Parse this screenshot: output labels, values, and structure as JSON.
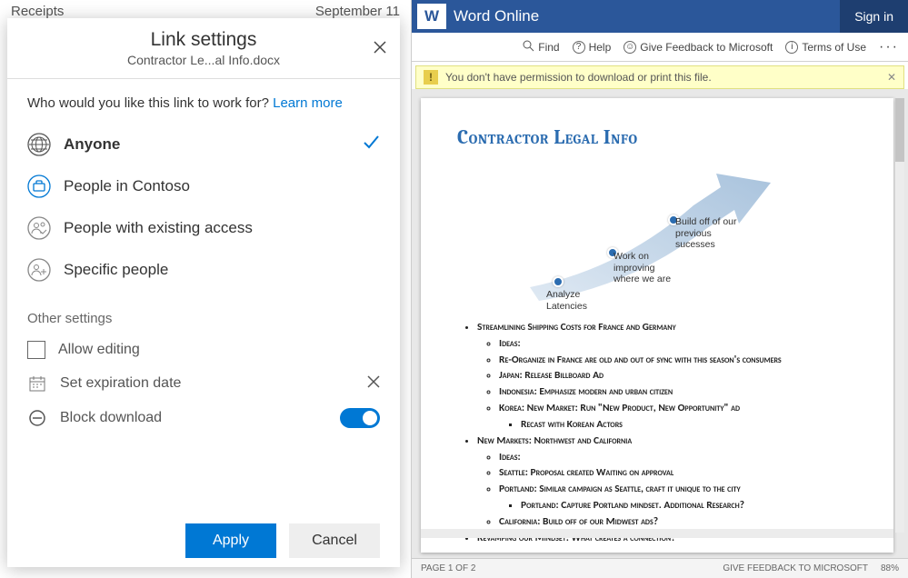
{
  "backdrop": {
    "left": "Receipts",
    "right": "September 11"
  },
  "dialog": {
    "title": "Link settings",
    "subtitle": "Contractor Le...al Info.docx",
    "prompt_prefix": "Who would you like this link to work for? ",
    "learn_more": "Learn more",
    "options": [
      {
        "label": "Anyone",
        "selected": true
      },
      {
        "label": "People in Contoso",
        "selected": false
      },
      {
        "label": "People with existing access",
        "selected": false
      },
      {
        "label": "Specific people",
        "selected": false
      }
    ],
    "other_settings_label": "Other settings",
    "allow_editing": "Allow editing",
    "set_expiration": "Set expiration date",
    "block_download": "Block download",
    "apply": "Apply",
    "cancel": "Cancel"
  },
  "word": {
    "app_name": "Word Online",
    "sign_in": "Sign in",
    "tools": {
      "find": "Find",
      "help": "Help",
      "feedback": "Give Feedback to Microsoft",
      "terms": "Terms of Use"
    },
    "warning": "You don't have permission to download or print this file.",
    "doc": {
      "title": "Contractor Legal Info",
      "bubbles": [
        {
          "text": "Analyze Latencies"
        },
        {
          "text": "Work on improving where we are"
        },
        {
          "text": "Build off of our previous sucesses"
        }
      ],
      "bullets": [
        {
          "t": "Streamlining Shipping Costs for France and Germany",
          "c": [
            {
              "t": "Ideas:"
            },
            {
              "t": "Re-Organize in France are old and out of sync with this season's consumers"
            },
            {
              "t": "Japan: Release  Billboard Ad"
            },
            {
              "t": "Indonesia: Emphasize modern and urban citizen"
            },
            {
              "t": "Korea: New Market:  Run \"New Product, New Opportunity\" ad",
              "c": [
                {
                  "t": "Recast with Korean Actors"
                }
              ]
            }
          ]
        },
        {
          "t": "New Markets: Northwest and California",
          "c": [
            {
              "t": "Ideas:"
            },
            {
              "t": "Seattle: Proposal created Waiting on approval"
            },
            {
              "t": "Portland: Similar campaign as Seattle, craft it unique to the city",
              "c": [
                {
                  "t": "Portland: Capture Portland mindset.  Additional Research?"
                }
              ]
            },
            {
              "t": "California:  Build off of our Midwest ads?"
            }
          ]
        },
        {
          "t": "Revamping our Mindset:  What creates a connection?"
        }
      ]
    },
    "status": {
      "page": "Page 1 of 2",
      "feedback": "Give feedback to Microsoft",
      "zoom": "88%"
    }
  }
}
